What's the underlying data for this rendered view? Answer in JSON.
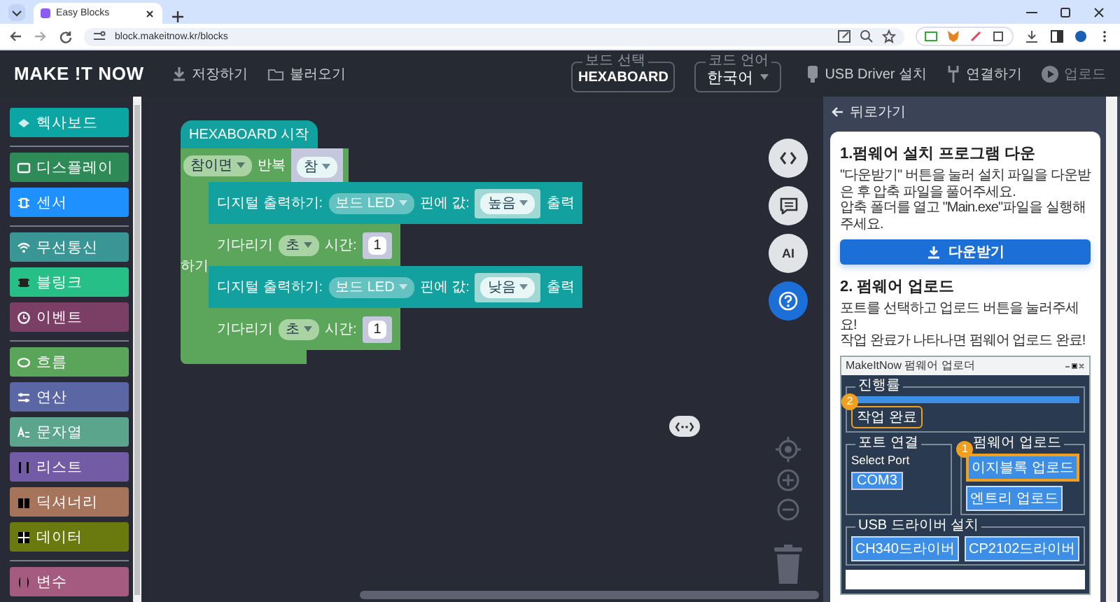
{
  "browser": {
    "tab_title": "Easy Blocks",
    "url": "block.makeitnow.kr/blocks"
  },
  "header": {
    "logo": "MAKE !T NOW",
    "file_actions": [
      {
        "kind": "save",
        "label": "저장하기"
      },
      {
        "kind": "open",
        "label": "불러오기"
      }
    ],
    "board_select": {
      "label": "보드 선택",
      "value": "HEXABOARD"
    },
    "language_select": {
      "label": "코드 언어",
      "value": "한국어"
    },
    "actions": [
      {
        "kind": "usb",
        "label": "USB Driver 설치",
        "disabled": false
      },
      {
        "kind": "connect",
        "label": "연결하기",
        "disabled": false
      },
      {
        "kind": "upload",
        "label": "업로드",
        "disabled": true
      }
    ]
  },
  "sidebar": {
    "groups": [
      {
        "items": [
          {
            "label": "헥사보드",
            "color": "#0ba5a3"
          }
        ]
      },
      {
        "items": [
          {
            "label": "디스플레이",
            "color": "#2e8b57"
          },
          {
            "label": "센서",
            "color": "#1e90ff"
          }
        ]
      },
      {
        "items": [
          {
            "label": "무선통신",
            "color": "#3a9595"
          },
          {
            "label": "블링크",
            "color": "#25bf87"
          },
          {
            "label": "이벤트",
            "color": "#7b3f66"
          }
        ]
      },
      {
        "items": [
          {
            "label": "흐름",
            "color": "#5ba55b"
          },
          {
            "label": "연산",
            "color": "#5b67a5"
          },
          {
            "label": "문자열",
            "color": "#5ba58c"
          },
          {
            "label": "리스트",
            "color": "#745ba5"
          },
          {
            "label": "딕셔너리",
            "color": "#a5745b"
          },
          {
            "label": "데이터",
            "color": "#6b7a0e"
          }
        ]
      },
      {
        "items": [
          {
            "label": "변수",
            "color": "#a55b80"
          }
        ]
      }
    ]
  },
  "workspace": {
    "start_block": "HEXABOARD 시작",
    "loop": {
      "mode": "참이면",
      "label": "반복",
      "condition": "참",
      "do_label": "하기",
      "body": [
        {
          "kind": "digital_write",
          "label": "디지털 출력하기:",
          "pin": "보드 LED",
          "mid": "핀에 값:",
          "value": "높음",
          "end": "출력"
        },
        {
          "kind": "wait",
          "label": "기다리기",
          "unit": "초",
          "mid": "시간:",
          "value": "1"
        },
        {
          "kind": "digital_write",
          "label": "디지털 출력하기:",
          "pin": "보드 LED",
          "mid": "핀에 값:",
          "value": "낮음",
          "end": "출력"
        },
        {
          "kind": "wait",
          "label": "기다리기",
          "unit": "초",
          "mid": "시간:",
          "value": "1"
        }
      ]
    },
    "floating_buttons": [
      {
        "kind": "code",
        "selected": false
      },
      {
        "kind": "chat",
        "selected": false
      },
      {
        "kind": "ai",
        "label": "AI",
        "selected": false
      },
      {
        "kind": "help",
        "selected": true
      }
    ]
  },
  "help_panel": {
    "back": "뒤로가기",
    "step1": {
      "title": "1.펌웨어 설치 프로그램 다운",
      "paragraphs": [
        "\"다운받기\" 버튼을 눌러 설치 파일을 다운받은 후 압축 파일을 풀어주세요.",
        "압축 폴더를 열고 \"Main.exe\"파일을 실행해 주세요."
      ],
      "button": "다운받기"
    },
    "step2": {
      "title": "2. 펌웨어 업로드",
      "paragraphs": [
        "포트를 선택하고 업로드 버튼을 눌러주세요!",
        "작업 완료가 나타나면 펌웨어 업로드 완료!"
      ]
    },
    "screenshot": {
      "title": "MakeItNow 펌웨어 업로더",
      "progress": {
        "legend": "진행률",
        "level": 1,
        "status": "작업 완료",
        "badge": "2"
      },
      "port": {
        "legend": "포트 연결",
        "label": "Select Port",
        "value": "COM3"
      },
      "firmware": {
        "legend": "펌웨어 업로드",
        "buttons": [
          {
            "label": "이지블록 업로드",
            "highlighted": true,
            "badge": "1"
          },
          {
            "label": "엔트리 업로드",
            "highlighted": false
          }
        ]
      },
      "usb": {
        "legend": "USB 드라이버 설치",
        "buttons": [
          "CH340드라이버",
          "CP2102드라이버"
        ]
      }
    }
  }
}
